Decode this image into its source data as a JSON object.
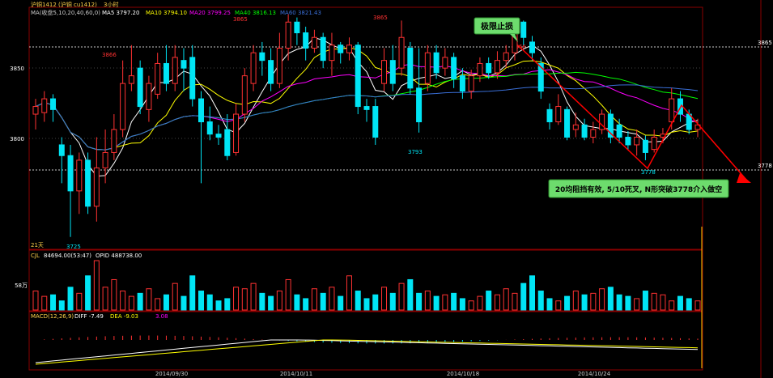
{
  "header": {
    "symbol": "沪铜1412 (沪铜 cu1412)",
    "period": "3小时",
    "ma_label": "MA(收盘5,10,20,40,60,0)",
    "ma5": "MA5 3797.20",
    "ma10": "MA10 3794.10",
    "ma20": "MA20 3799.25",
    "ma40": "MA40 3816.13",
    "ma60": "MA60 3821.43"
  },
  "colors": {
    "up": "#ff3232",
    "down": "#00e5f5",
    "ma5": "#ffffff",
    "ma10": "#ffff00",
    "ma20": "#ff00ff",
    "ma40": "#00ff00",
    "ma60": "#3a6fd8",
    "trend": "#ff0000",
    "annotation_box": "#6ddc6d"
  },
  "price_axis": {
    "ticks": [
      "3850",
      "3800"
    ],
    "right_labels": [
      "3865",
      "3778"
    ]
  },
  "candle_labels": [
    "3866",
    "3865",
    "3865",
    "3866",
    "3793",
    "3725",
    "3778"
  ],
  "annotations": {
    "top": "极限止损",
    "bottom": "20均阻挡有效, 5/10死叉, N形突破3778介入做空"
  },
  "period_label": "21天",
  "volume_panel": {
    "label": "CJL",
    "cjl": "84694.00(53:47)",
    "opid": "OPID 488738.00",
    "tick": "58万"
  },
  "macd_panel": {
    "label": "MACD(12,26,9)",
    "diff": "DIFF -7.49",
    "dea": "DEA -9.03",
    "macd": "3.08"
  },
  "x_axis": [
    "2014/09/30",
    "2014/10/11",
    "2014/10/18",
    "2014/10/24"
  ],
  "chart_data": {
    "type": "candlestick",
    "title": "沪铜1412 3小时",
    "ylim": [
      3718,
      3872
    ],
    "candles": [
      {
        "o": 3805,
        "c": 3810,
        "h": 3815,
        "l": 3795
      },
      {
        "o": 3806,
        "c": 3815,
        "h": 3820,
        "l": 3800
      },
      {
        "o": 3815,
        "c": 3808,
        "h": 3818,
        "l": 3800
      },
      {
        "o": 3785,
        "c": 3778,
        "h": 3790,
        "l": 3760
      },
      {
        "o": 3778,
        "c": 3755,
        "h": 3785,
        "l": 3725
      },
      {
        "o": 3755,
        "c": 3775,
        "h": 3780,
        "l": 3740
      },
      {
        "o": 3775,
        "c": 3745,
        "h": 3780,
        "l": 3740
      },
      {
        "o": 3745,
        "c": 3770,
        "h": 3790,
        "l": 3735
      },
      {
        "o": 3770,
        "c": 3780,
        "h": 3795,
        "l": 3760
      },
      {
        "o": 3780,
        "c": 3795,
        "h": 3805,
        "l": 3775
      },
      {
        "o": 3795,
        "c": 3825,
        "h": 3840,
        "l": 3790
      },
      {
        "o": 3825,
        "c": 3830,
        "h": 3850,
        "l": 3820
      },
      {
        "o": 3835,
        "c": 3810,
        "h": 3840,
        "l": 3805
      },
      {
        "o": 3808,
        "c": 3825,
        "h": 3830,
        "l": 3800
      },
      {
        "o": 3818,
        "c": 3838,
        "h": 3845,
        "l": 3815
      },
      {
        "o": 3838,
        "c": 3825,
        "h": 3850,
        "l": 3820
      },
      {
        "o": 3825,
        "c": 3842,
        "h": 3850,
        "l": 3820
      },
      {
        "o": 3840,
        "c": 3835,
        "h": 3848,
        "l": 3820
      },
      {
        "o": 3842,
        "c": 3815,
        "h": 3850,
        "l": 3810
      },
      {
        "o": 3815,
        "c": 3800,
        "h": 3820,
        "l": 3760
      },
      {
        "o": 3800,
        "c": 3792,
        "h": 3810,
        "l": 3788
      },
      {
        "o": 3792,
        "c": 3790,
        "h": 3798,
        "l": 3785
      },
      {
        "o": 3795,
        "c": 3778,
        "h": 3805,
        "l": 3775
      },
      {
        "o": 3780,
        "c": 3805,
        "h": 3812,
        "l": 3778
      },
      {
        "o": 3805,
        "c": 3830,
        "h": 3835,
        "l": 3800
      },
      {
        "o": 3825,
        "c": 3845,
        "h": 3850,
        "l": 3820
      },
      {
        "o": 3845,
        "c": 3840,
        "h": 3852,
        "l": 3830
      },
      {
        "o": 3840,
        "c": 3825,
        "h": 3848,
        "l": 3820
      },
      {
        "o": 3825,
        "c": 3848,
        "h": 3858,
        "l": 3822
      },
      {
        "o": 3848,
        "c": 3865,
        "h": 3870,
        "l": 3840
      },
      {
        "o": 3865,
        "c": 3858,
        "h": 3868,
        "l": 3850
      },
      {
        "o": 3858,
        "c": 3848,
        "h": 3862,
        "l": 3840
      },
      {
        "o": 3848,
        "c": 3855,
        "h": 3860,
        "l": 3845
      },
      {
        "o": 3855,
        "c": 3840,
        "h": 3858,
        "l": 3835
      },
      {
        "o": 3840,
        "c": 3850,
        "h": 3858,
        "l": 3830
      },
      {
        "o": 3850,
        "c": 3845,
        "h": 3852,
        "l": 3838
      },
      {
        "o": 3845,
        "c": 3850,
        "h": 3855,
        "l": 3840
      },
      {
        "o": 3850,
        "c": 3810,
        "h": 3852,
        "l": 3805
      },
      {
        "o": 3810,
        "c": 3808,
        "h": 3815,
        "l": 3800
      },
      {
        "o": 3810,
        "c": 3790,
        "h": 3815,
        "l": 3785
      },
      {
        "o": 3825,
        "c": 3840,
        "h": 3848,
        "l": 3820
      },
      {
        "o": 3840,
        "c": 3825,
        "h": 3850,
        "l": 3820
      },
      {
        "o": 3835,
        "c": 3855,
        "h": 3866,
        "l": 3830
      },
      {
        "o": 3848,
        "c": 3822,
        "h": 3852,
        "l": 3818
      },
      {
        "o": 3822,
        "c": 3800,
        "h": 3848,
        "l": 3793
      },
      {
        "o": 3825,
        "c": 3845,
        "h": 3850,
        "l": 3820
      },
      {
        "o": 3845,
        "c": 3832,
        "h": 3850,
        "l": 3828
      },
      {
        "o": 3835,
        "c": 3842,
        "h": 3848,
        "l": 3830
      },
      {
        "o": 3842,
        "c": 3828,
        "h": 3845,
        "l": 3822
      },
      {
        "o": 3830,
        "c": 3820,
        "h": 3835,
        "l": 3815
      },
      {
        "o": 3820,
        "c": 3830,
        "h": 3834,
        "l": 3815
      },
      {
        "o": 3830,
        "c": 3838,
        "h": 3842,
        "l": 3826
      },
      {
        "o": 3838,
        "c": 3832,
        "h": 3842,
        "l": 3828
      },
      {
        "o": 3832,
        "c": 3840,
        "h": 3846,
        "l": 3828
      },
      {
        "o": 3840,
        "c": 3845,
        "h": 3850,
        "l": 3835
      },
      {
        "o": 3845,
        "c": 3865,
        "h": 3866,
        "l": 3840
      },
      {
        "o": 3865,
        "c": 3855,
        "h": 3866,
        "l": 3850
      },
      {
        "o": 3852,
        "c": 3845,
        "h": 3856,
        "l": 3840
      },
      {
        "o": 3838,
        "c": 3820,
        "h": 3842,
        "l": 3815
      },
      {
        "o": 3808,
        "c": 3800,
        "h": 3812,
        "l": 3795
      },
      {
        "o": 3800,
        "c": 3810,
        "h": 3818,
        "l": 3798
      },
      {
        "o": 3808,
        "c": 3790,
        "h": 3810,
        "l": 3788
      },
      {
        "o": 3795,
        "c": 3798,
        "h": 3806,
        "l": 3790
      },
      {
        "o": 3798,
        "c": 3790,
        "h": 3802,
        "l": 3788
      },
      {
        "o": 3790,
        "c": 3795,
        "h": 3800,
        "l": 3786
      },
      {
        "o": 3795,
        "c": 3805,
        "h": 3808,
        "l": 3792
      },
      {
        "o": 3805,
        "c": 3790,
        "h": 3808,
        "l": 3786
      },
      {
        "o": 3798,
        "c": 3790,
        "h": 3802,
        "l": 3786
      },
      {
        "o": 3790,
        "c": 3785,
        "h": 3794,
        "l": 3782
      },
      {
        "o": 3785,
        "c": 3790,
        "h": 3795,
        "l": 3778
      },
      {
        "o": 3788,
        "c": 3780,
        "h": 3791,
        "l": 3775
      },
      {
        "o": 3782,
        "c": 3790,
        "h": 3795,
        "l": 3780
      },
      {
        "o": 3790,
        "c": 3792,
        "h": 3796,
        "l": 3786
      },
      {
        "o": 3800,
        "c": 3815,
        "h": 3822,
        "l": 3795
      },
      {
        "o": 3815,
        "c": 3805,
        "h": 3820,
        "l": 3800
      },
      {
        "o": 3805,
        "c": 3795,
        "h": 3808,
        "l": 3792
      },
      {
        "o": 3795,
        "c": 3798,
        "h": 3802,
        "l": 3790
      }
    ],
    "volume": [
      25,
      18,
      20,
      12,
      30,
      22,
      45,
      65,
      30,
      40,
      25,
      18,
      22,
      28,
      15,
      20,
      35,
      18,
      45,
      25,
      20,
      12,
      15,
      30,
      28,
      35,
      22,
      18,
      25,
      40,
      20,
      15,
      28,
      22,
      30,
      18,
      45,
      25,
      15,
      20,
      30,
      22,
      35,
      40,
      22,
      25,
      18,
      20,
      22,
      15,
      12,
      18,
      25,
      20,
      28,
      22,
      35,
      45,
      25,
      15,
      12,
      18,
      25,
      20,
      22,
      28,
      30,
      20,
      18,
      15,
      25,
      22,
      20,
      12,
      18,
      15,
      12
    ]
  }
}
